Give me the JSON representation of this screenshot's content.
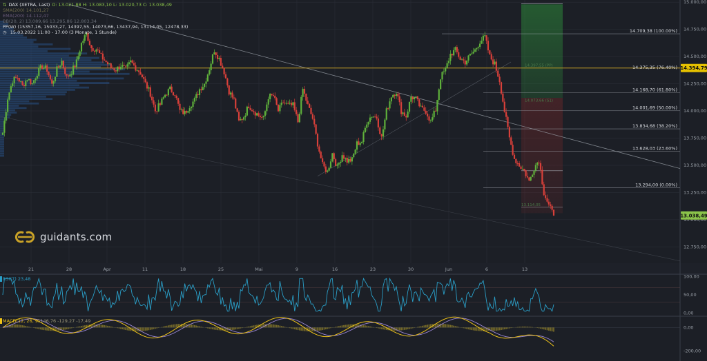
{
  "header": {
    "symbol": "DAX (XETRA, Last)",
    "ohlc": "O: 13.021,88  H: 13.083,10  L: 13.020,73  C: 13.038,49",
    "sma200": "SMA(200)  14.101,27",
    "ema200": "EMA(200)  14.112,47",
    "bb": "BB(20, 2)  13.089,66  13.295,86  12.803,34",
    "ppw": "PP(W)  (15357,16, 15033,27, 14397,55, 14073,66, 13437,94, 13114,05, 12478,33)",
    "timerange": "15.03.2022 11:00 - 17:00  (3 Monate, 1 Stunde)"
  },
  "colors": {
    "background": "#1c1f26",
    "up": "#5fb13b",
    "down": "#d9403a",
    "grid": "#2a2e37",
    "pivot_line": "#c9a227",
    "price_tag": "#8bc34a",
    "pivot_tag": "#e5c100",
    "rsi": "#2aa0c9",
    "macd": "#f0c419",
    "signal": "#9b87d8",
    "hist": "#8a7a2a",
    "volume_profile": "#2a5a9c",
    "text": "#c8ccd4"
  },
  "logo": {
    "text": "guidants.com",
    "icon": "guidants-logo-icon"
  },
  "chart_data": [
    {
      "type": "candlestick",
      "title": "DAX (XETRA, Last)",
      "x_tick_labels": [
        "21",
        "28",
        "Apr",
        "11",
        "18",
        "25",
        "Mai",
        "9",
        "16",
        "23",
        "30",
        "Jun",
        "6",
        "13"
      ],
      "y_ticks": [
        12750,
        13000,
        13250,
        13500,
        13750,
        14000,
        14250,
        14500,
        14750,
        15000
      ],
      "y_tick_labels": [
        "12.750,00",
        "13.000,00",
        "13.250,00",
        "13.500,00",
        "13.750,00",
        "14.000,00",
        "14.250,00",
        "14.500,00",
        "14.750,00",
        "15.000,00"
      ],
      "ylim": [
        12600,
        15020
      ],
      "grid": true,
      "closes": [
        13800,
        14120,
        14280,
        14310,
        14230,
        14300,
        14250,
        14350,
        14410,
        14380,
        14240,
        14380,
        14460,
        14310,
        14360,
        14450,
        14620,
        14710,
        14580,
        14570,
        14500,
        14450,
        14400,
        14380,
        14420,
        14380,
        14450,
        14400,
        14350,
        14250,
        14160,
        14000,
        14060,
        14150,
        14200,
        14160,
        14000,
        13980,
        14050,
        14100,
        14200,
        14250,
        14390,
        14560,
        14480,
        14360,
        14180,
        14100,
        13900,
        13950,
        14050,
        14000,
        13960,
        13930,
        14130,
        14140,
        14000,
        14080,
        14050,
        14050,
        13900,
        14200,
        14050,
        13930,
        13700,
        13500,
        13440,
        13610,
        13480,
        13600,
        13540,
        13550,
        13700,
        13720,
        13900,
        13960,
        13940,
        13750,
        14000,
        14140,
        14180,
        14000,
        13950,
        14130,
        14110,
        14020,
        14000,
        13900,
        14010,
        14310,
        14380,
        14520,
        14560,
        14480,
        14450,
        14510,
        14560,
        14640,
        14680,
        14500,
        14430,
        14280,
        14000,
        13750,
        13560,
        13500,
        13450,
        13350,
        13480,
        13550,
        13250,
        13130,
        13038
      ],
      "annotations": [
        {
          "value": 14709.38,
          "label": "14.709,38 (100.00%)"
        },
        {
          "value": 14375.35,
          "label": "14.375,35 (76.40%)"
        },
        {
          "value": 14168.7,
          "label": "14.168,70 (61.80%)"
        },
        {
          "value": 14001.69,
          "label": "14.001,69 (50.00%)"
        },
        {
          "value": 13834.68,
          "label": "13.834,68 (38.20%)"
        },
        {
          "value": 13628.03,
          "label": "13.628,03 (23.60%)"
        },
        {
          "value": 13294.0,
          "label": "13.294,00 (0.00%)"
        }
      ],
      "price_tags": [
        {
          "value": 14394.79,
          "label": "14.394,79"
        },
        {
          "value": 13038.49,
          "label": "13.038,49"
        }
      ],
      "faint_labels": [
        "14.397,55 (PP)",
        "14.073,66 (S1)",
        "13.114,05"
      ]
    },
    {
      "type": "line",
      "title": "RSI(7)  23,48",
      "y_ticks": [
        0,
        50,
        100
      ],
      "y_tick_labels": [
        "0,00",
        "50,00",
        "100,00"
      ],
      "ylim": [
        -5,
        105
      ],
      "last_value": 23.48
    },
    {
      "type": "line",
      "title": "MACD(12, 26, 9)",
      "header_values": "-146,76   -129,27   -17,49",
      "y_ticks": [
        0,
        -200
      ],
      "y_tick_labels": [
        "0,00",
        "-200,00"
      ],
      "ylim": [
        -250,
        90
      ]
    }
  ]
}
